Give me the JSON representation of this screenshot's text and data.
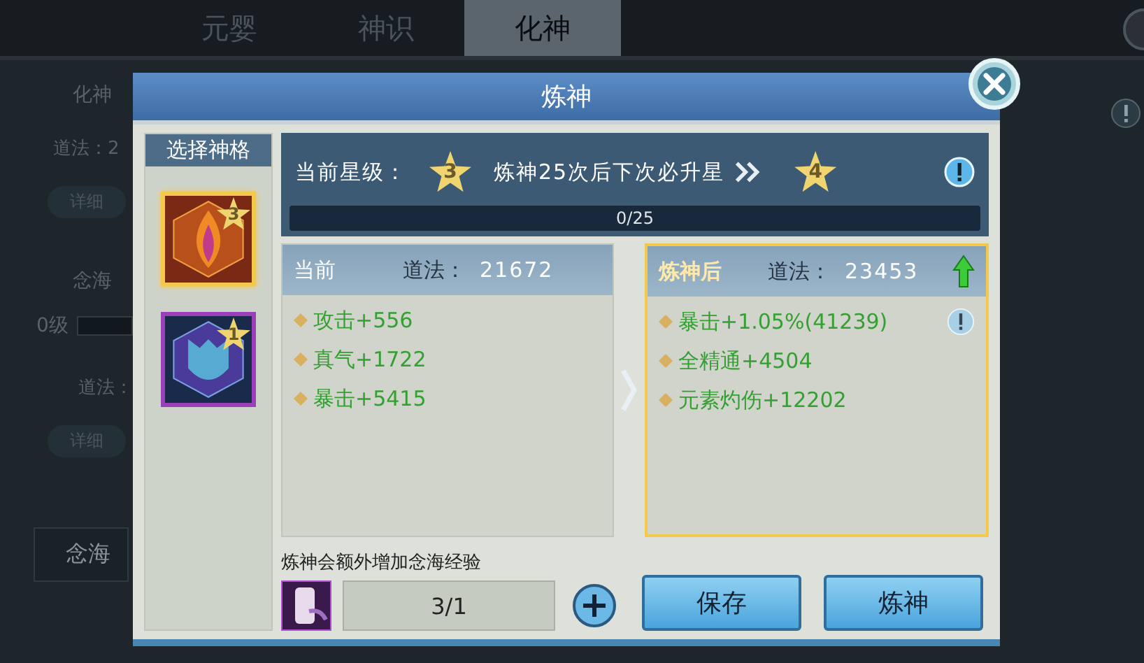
{
  "tabs": [
    {
      "label": "元婴",
      "selected": false
    },
    {
      "label": "神识",
      "selected": false
    },
    {
      "label": "化神",
      "selected": true
    }
  ],
  "background": {
    "section_1": "化神",
    "stat_1": "道法：2",
    "details_button_1": "详细",
    "section_2": "念海",
    "level": "0级",
    "stat_2": "道法：",
    "details_button_2": "详细",
    "bottom_button": "念海"
  },
  "dialog": {
    "title": "炼神",
    "sidebar": {
      "header": "选择神格",
      "items": [
        {
          "stars": "3",
          "selected": true,
          "kind": "flame"
        },
        {
          "stars": "1",
          "selected": false,
          "kind": "shield"
        }
      ]
    },
    "star_row": {
      "label": "当前星级：",
      "current_star": "3",
      "message": "炼神25次后下次必升星",
      "next_star": "4"
    },
    "progress": {
      "text": "0/25",
      "level": 0
    },
    "panels": [
      {
        "title": "当前",
        "stat_label": "道法：",
        "stat_value": "21672",
        "highlighted": false,
        "trend_up": false,
        "attributes": [
          {
            "text": "攻击+556",
            "info": false
          },
          {
            "text": "真气+1722",
            "info": false
          },
          {
            "text": "暴击+5415",
            "info": false
          }
        ]
      },
      {
        "title": "炼神后",
        "stat_label": "道法：",
        "stat_value": "23453",
        "highlighted": true,
        "trend_up": true,
        "attributes": [
          {
            "text": "暴击+1.05%(41239)",
            "info": true
          },
          {
            "text": "全精通+4504",
            "info": false
          },
          {
            "text": "元素灼伤+12202",
            "info": false
          }
        ]
      }
    ],
    "material": {
      "note": "炼神会额外增加念海经验",
      "count": "3/1"
    },
    "buttons": [
      "保存",
      "炼神"
    ]
  }
}
